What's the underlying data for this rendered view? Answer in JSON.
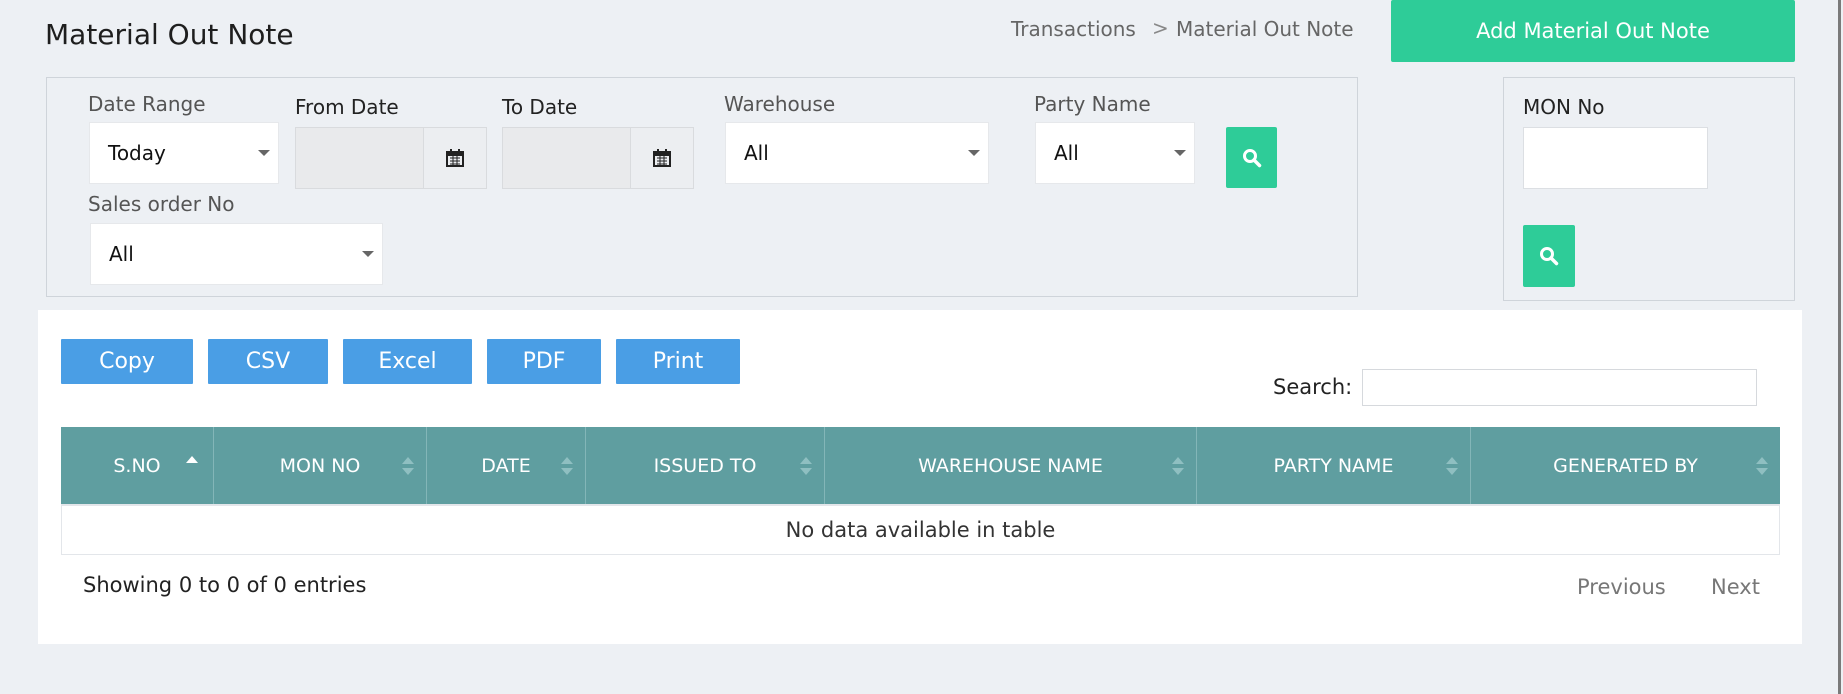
{
  "page": {
    "title": "Material Out Note"
  },
  "breadcrumb": {
    "parent": "Transactions",
    "separator": ">",
    "current": "Material Out Note"
  },
  "actions": {
    "add_label": "Add Material Out Note"
  },
  "filters": {
    "date_range": {
      "label": "Date Range",
      "value": "Today"
    },
    "from_date": {
      "label": "From Date",
      "value": ""
    },
    "to_date": {
      "label": "To Date",
      "value": ""
    },
    "warehouse": {
      "label": "Warehouse",
      "value": "All"
    },
    "party_name": {
      "label": "Party Name",
      "value": "All"
    },
    "sales_order": {
      "label": "Sales order No",
      "value": "All"
    }
  },
  "mon_filter": {
    "label": "MON No",
    "value": ""
  },
  "export_buttons": [
    "Copy",
    "CSV",
    "Excel",
    "PDF",
    "Print"
  ],
  "search": {
    "label": "Search:",
    "value": ""
  },
  "table": {
    "columns": [
      "S.NO",
      "MON NO",
      "DATE",
      "ISSUED TO",
      "WAREHOUSE NAME",
      "PARTY NAME",
      "GENERATED BY"
    ],
    "empty_message": "No data available in table",
    "info": "Showing 0 to 0 of 0 entries"
  },
  "pagination": {
    "previous": "Previous",
    "next": "Next"
  },
  "colors": {
    "accent_green": "#2ecc98",
    "button_blue": "#4a9ee5",
    "table_header": "#5f9ea0",
    "background": "#edf0f4"
  },
  "icons": {
    "calendar": "calendar-icon",
    "search": "search-icon",
    "dropdown": "chevron-down-icon"
  }
}
